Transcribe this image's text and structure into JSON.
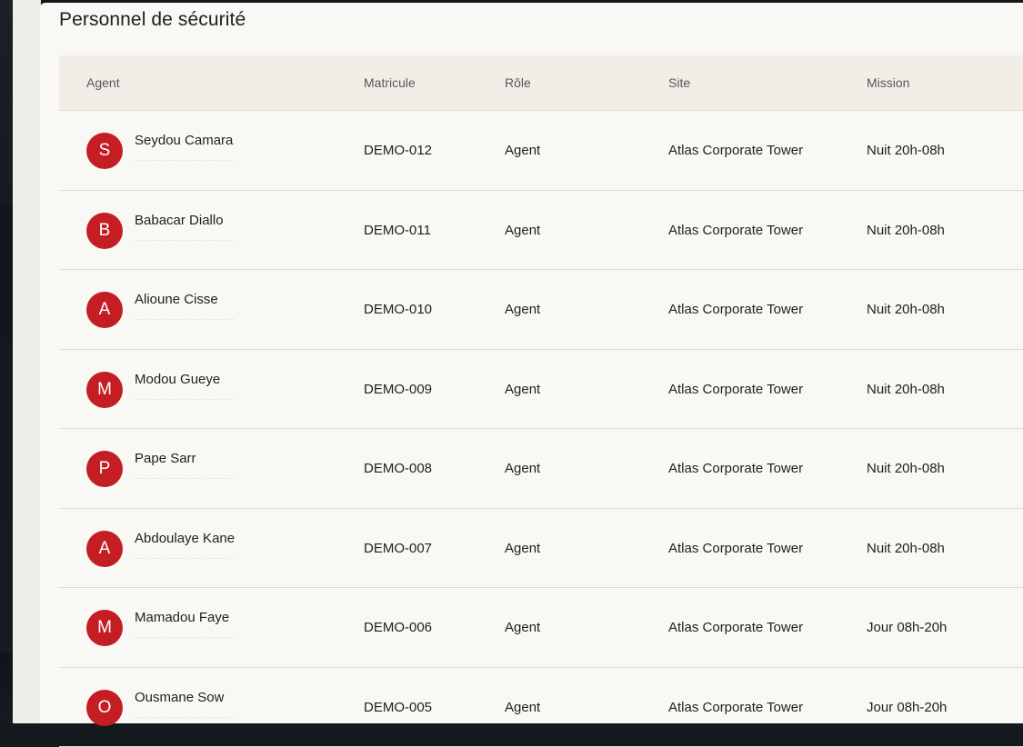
{
  "page": {
    "title": "Personnel de sécurité"
  },
  "table": {
    "columns": [
      "Agent",
      "Matricule",
      "Rôle",
      "Site",
      "Mission"
    ],
    "rows": [
      {
        "initial": "S",
        "name": "Seydou Camara",
        "matricule": "DEMO-012",
        "role": "Agent",
        "site": "Atlas Corporate Tower",
        "mission": "Nuit 20h-08h"
      },
      {
        "initial": "B",
        "name": "Babacar Diallo",
        "matricule": "DEMO-011",
        "role": "Agent",
        "site": "Atlas Corporate Tower",
        "mission": "Nuit 20h-08h"
      },
      {
        "initial": "A",
        "name": "Alioune Cisse",
        "matricule": "DEMO-010",
        "role": "Agent",
        "site": "Atlas Corporate Tower",
        "mission": "Nuit 20h-08h"
      },
      {
        "initial": "M",
        "name": "Modou Gueye",
        "matricule": "DEMO-009",
        "role": "Agent",
        "site": "Atlas Corporate Tower",
        "mission": "Nuit 20h-08h"
      },
      {
        "initial": "P",
        "name": "Pape Sarr",
        "matricule": "DEMO-008",
        "role": "Agent",
        "site": "Atlas Corporate Tower",
        "mission": "Nuit 20h-08h"
      },
      {
        "initial": "A",
        "name": "Abdoulaye Kane",
        "matricule": "DEMO-007",
        "role": "Agent",
        "site": "Atlas Corporate Tower",
        "mission": "Nuit 20h-08h"
      },
      {
        "initial": "M",
        "name": "Mamadou Faye",
        "matricule": "DEMO-006",
        "role": "Agent",
        "site": "Atlas Corporate Tower",
        "mission": "Jour 08h-20h"
      },
      {
        "initial": "O",
        "name": "Ousmane Sow",
        "matricule": "DEMO-005",
        "role": "Agent",
        "site": "Atlas Corporate Tower",
        "mission": "Jour 08h-20h"
      }
    ]
  },
  "colors": {
    "avatar": "#c41e24",
    "card_bg": "#f9f8f5",
    "header_bg": "#f1eee8"
  }
}
